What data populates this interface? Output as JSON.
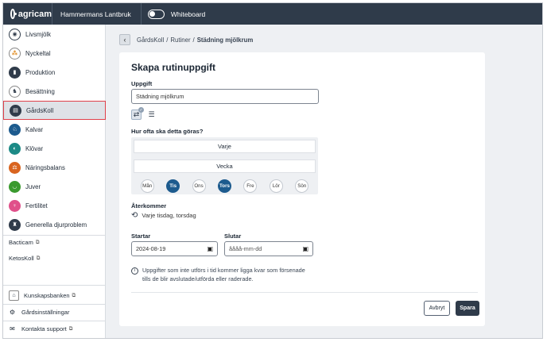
{
  "topbar": {
    "logo_text": "agricam",
    "farm_name": "Hammermans Lantbruk",
    "whiteboard_label": "Whiteboard"
  },
  "sidebar": {
    "items": [
      {
        "label": "Livsmjölk",
        "icon": "cow-circle-icon",
        "color": "#ffffff"
      },
      {
        "label": "Nyckeltal",
        "icon": "chart-dots-icon",
        "color": "#ffffff"
      },
      {
        "label": "Produktion",
        "icon": "milk-bottles-icon",
        "color": "#2f3b4a"
      },
      {
        "label": "Besättning",
        "icon": "herd-icon",
        "color": "#ffffff"
      },
      {
        "label": "GårdsKoll",
        "icon": "clipboard-icon",
        "color": "#2f3b4a"
      },
      {
        "label": "Kalvar",
        "icon": "calf-icon",
        "color": "#1d5b8e"
      },
      {
        "label": "Klövar",
        "icon": "hoof-icon",
        "color": "#1c8a86"
      },
      {
        "label": "Näringsbalans",
        "icon": "nutrition-icon",
        "color": "#d9641f"
      },
      {
        "label": "Juver",
        "icon": "udder-icon",
        "color": "#3a9a2e"
      },
      {
        "label": "Fertilitet",
        "icon": "fertility-icon",
        "color": "#e0508a"
      },
      {
        "label": "Generella djurproblem",
        "icon": "animal-problem-icon",
        "color": "#2f3b4a"
      }
    ],
    "links": [
      {
        "label": "Bacticam"
      },
      {
        "label": "KetosKoll"
      }
    ],
    "knowledge_bank": "Kunskapsbanken",
    "settings": "Gårdsinställningar",
    "support": "Kontakta support"
  },
  "breadcrumb": {
    "part1": "GårdsKoll",
    "sep": "/",
    "part2": "Rutiner",
    "current": "Städning mjölkrum"
  },
  "form": {
    "title": "Skapa rutinuppgift",
    "task_label": "Uppgift",
    "task_value": "Städning mjölkrum",
    "frequency_question": "Hur ofta ska detta göras?",
    "frequency_value": "Varje",
    "period_value": "Vecka",
    "days": [
      {
        "label": "Mån",
        "selected": false
      },
      {
        "label": "Tis",
        "selected": true
      },
      {
        "label": "Ons",
        "selected": false
      },
      {
        "label": "Tors",
        "selected": true
      },
      {
        "label": "Fre",
        "selected": false
      },
      {
        "label": "Lör",
        "selected": false
      },
      {
        "label": "Sön",
        "selected": false
      }
    ],
    "recurs_label": "Återkommer",
    "recurs_text": "Varje tisdag, torsdag",
    "start_label": "Startar",
    "start_value": "2024-08-19",
    "end_label": "Slutar",
    "end_placeholder": "åååå-mm-dd",
    "info_text": "Uppgifter som inte utförs i tid kommer ligga kvar som försenade tills de blir avslutade/utförda eller raderade.",
    "cancel_label": "Avbryt",
    "save_label": "Spara"
  },
  "colors": {
    "accent": "#1d5b8e",
    "topbar": "#2f3b4a",
    "highlight_border": "#e0404a"
  }
}
